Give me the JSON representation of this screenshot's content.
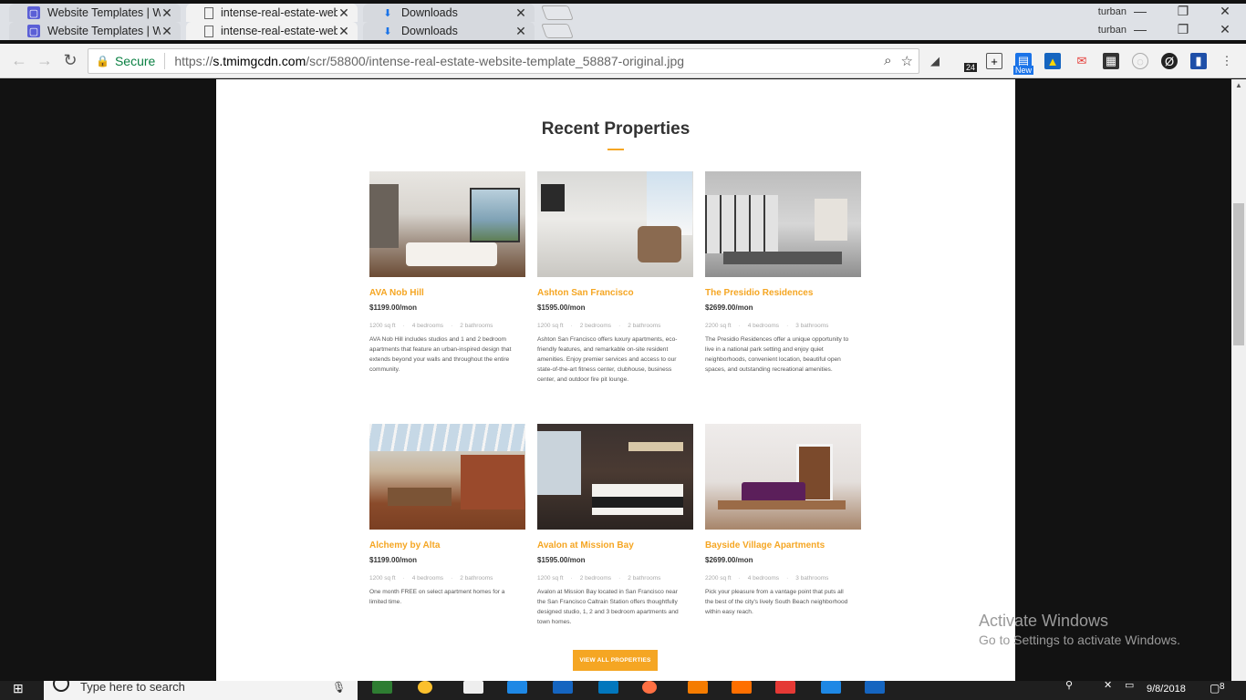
{
  "browser": {
    "tabs_row1": [
      {
        "label": "Website Templates | Web",
        "icon": "template-monster-icon",
        "state": "inactive"
      },
      {
        "label": "intense-real-estate-websi",
        "icon": "page-icon",
        "state": "active"
      },
      {
        "label": "Downloads",
        "icon": "download-icon",
        "state": "inactive"
      }
    ],
    "tabs_row2": [
      {
        "label": "Website Templates | Web",
        "icon": "template-monster-icon",
        "state": "inactive"
      },
      {
        "label": "intense-real-estate-websi",
        "icon": "page-icon",
        "state": "active"
      },
      {
        "label": "Downloads",
        "icon": "download-icon",
        "state": "inactive"
      }
    ],
    "user": "turban",
    "secure_label": "Secure",
    "url": {
      "scheme": "https://",
      "host": "s.tmimgcdn.com",
      "path": "/scr/58800/intense-real-estate-website-template_58887-original.jpg"
    },
    "ext_badges": {
      "counter": "24",
      "new": "New"
    }
  },
  "page": {
    "section_title": "Recent Properties",
    "properties": [
      {
        "name": "AVA Nob Hill",
        "price": "$1199.00/mon",
        "sqft": "1200 sq ft",
        "bedrooms": "4 bedrooms",
        "bathrooms": "2 bathrooms",
        "description": "AVA Nob Hill includes studios and 1 and 2 bedroom apartments that feature an urban-inspired design that extends beyond your walls and throughout the entire community."
      },
      {
        "name": "Ashton San Francisco",
        "price": "$1595.00/mon",
        "sqft": "1200 sq ft",
        "bedrooms": "2 bedrooms",
        "bathrooms": "2 bathrooms",
        "description": "Ashton San Francisco offers luxury apartments, eco-friendly features, and remarkable on-site resident amenities. Enjoy premier services and access to our state-of-the-art fitness center, clubhouse, business center, and outdoor fire pit lounge."
      },
      {
        "name": "The Presidio Residences",
        "price": "$2699.00/mon",
        "sqft": "2200 sq ft",
        "bedrooms": "4 bedrooms",
        "bathrooms": "3 bathrooms",
        "description": "The Presidio Residences offer a unique opportunity to live in a national park setting and enjoy quiet neighborhoods, convenient location, beautiful open spaces, and outstanding recreational amenities."
      },
      {
        "name": "Alchemy by Alta",
        "price": "$1199.00/mon",
        "sqft": "1200 sq ft",
        "bedrooms": "4 bedrooms",
        "bathrooms": "2 bathrooms",
        "description": "One month FREE on select apartment homes for a limited time."
      },
      {
        "name": "Avalon at Mission Bay",
        "price": "$1595.00/mon",
        "sqft": "1200 sq ft",
        "bedrooms": "2 bedrooms",
        "bathrooms": "2 bathrooms",
        "description": "Avalon at Mission Bay located in San Francisco near the San Francisco Caltrain Station offers thoughtfully designed studio, 1, 2 and 3 bedroom apartments and town homes."
      },
      {
        "name": "Bayside Village Apartments",
        "price": "$2699.00/mon",
        "sqft": "2200 sq ft",
        "bedrooms": "4 bedrooms",
        "bathrooms": "3 bathrooms",
        "description": "Pick your pleasure from a vantage point that puts all the best of the city's lively South Beach neighborhood within easy reach."
      }
    ],
    "view_all_label": "VIEW ALL PROPERTIES"
  },
  "overlay": {
    "activate_title": "Activate Windows",
    "activate_sub": "Go to Settings to activate Windows."
  },
  "taskbar": {
    "search_placeholder": "Type here to search",
    "date": "9/8/2018",
    "notification_count": "8"
  },
  "colors": {
    "accent": "#f5a623",
    "page_bg": "#ffffff",
    "outer_bg": "#121212"
  }
}
